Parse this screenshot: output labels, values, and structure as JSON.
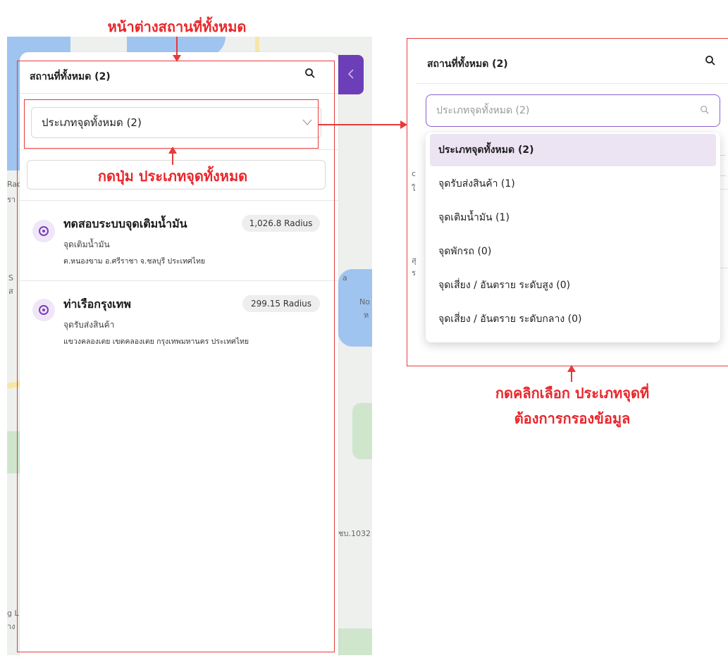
{
  "annotations": {
    "top_title": "หน้าต่างสถานที่ทั้งหมด",
    "click_type_button": "กดปุ่ม ประเภทจุดทั้งหมด",
    "choose_type_line1": "กดคลิกเลือก ประเภทจุดที่",
    "choose_type_line2": "ต้องการกรองข้อมูล"
  },
  "map_labels": {
    "l1": "Rac",
    "l2": "รา",
    "l3": "S",
    "l4": "ส",
    "l5": "a",
    "l6": "No",
    "l7": "ห",
    "l8": "ชบ.1032",
    "l9": "g L",
    "l10": "าง"
  },
  "left_panel": {
    "title": "สถานที่ทั้งหมด (2)",
    "type_select_value": "ประเภทจุดทั้งหมด (2)",
    "locations": [
      {
        "name": "ทดสอบระบบจุดเติมน้ำมัน",
        "radius": "1,026.8 Radius",
        "type": "จุดเติมน้ำมัน",
        "address": "ต.หนองขาม อ.ศรีราชา จ.ชลบุรี ประเทศไทย"
      },
      {
        "name": "ท่าเรือกรุงเทพ",
        "radius": "299.15 Radius",
        "type": "จุดรับส่งสินค้า",
        "address": "แขวงคลองเตย เขตคลองเตย กรุงเทพมหานคร ประเทศไทย"
      }
    ]
  },
  "right_panel": {
    "title": "สถานที่ทั้งหมด (2)",
    "search_placeholder": "ประเภทจุดทั้งหมด (2)",
    "options": [
      "ประเภทจุดทั้งหมด (2)",
      "จุดรับส่งสินค้า (1)",
      "จุดเติมน้ำมัน (1)",
      "จุดพักรถ (0)",
      "จุดเสี่ยง / อันตราย ระดับสูง (0)",
      "จุดเสี่ยง / อันตราย ระดับกลาง (0)"
    ],
    "selected_option": 0,
    "bg_fragments": {
      "c": "c",
      "n": "ใ",
      "r": "ร",
      "s": "สุ"
    }
  },
  "colors": {
    "accent": "#7a3fb8",
    "annotation_red": "#e8262b",
    "selected_bg": "#ece4f3"
  }
}
